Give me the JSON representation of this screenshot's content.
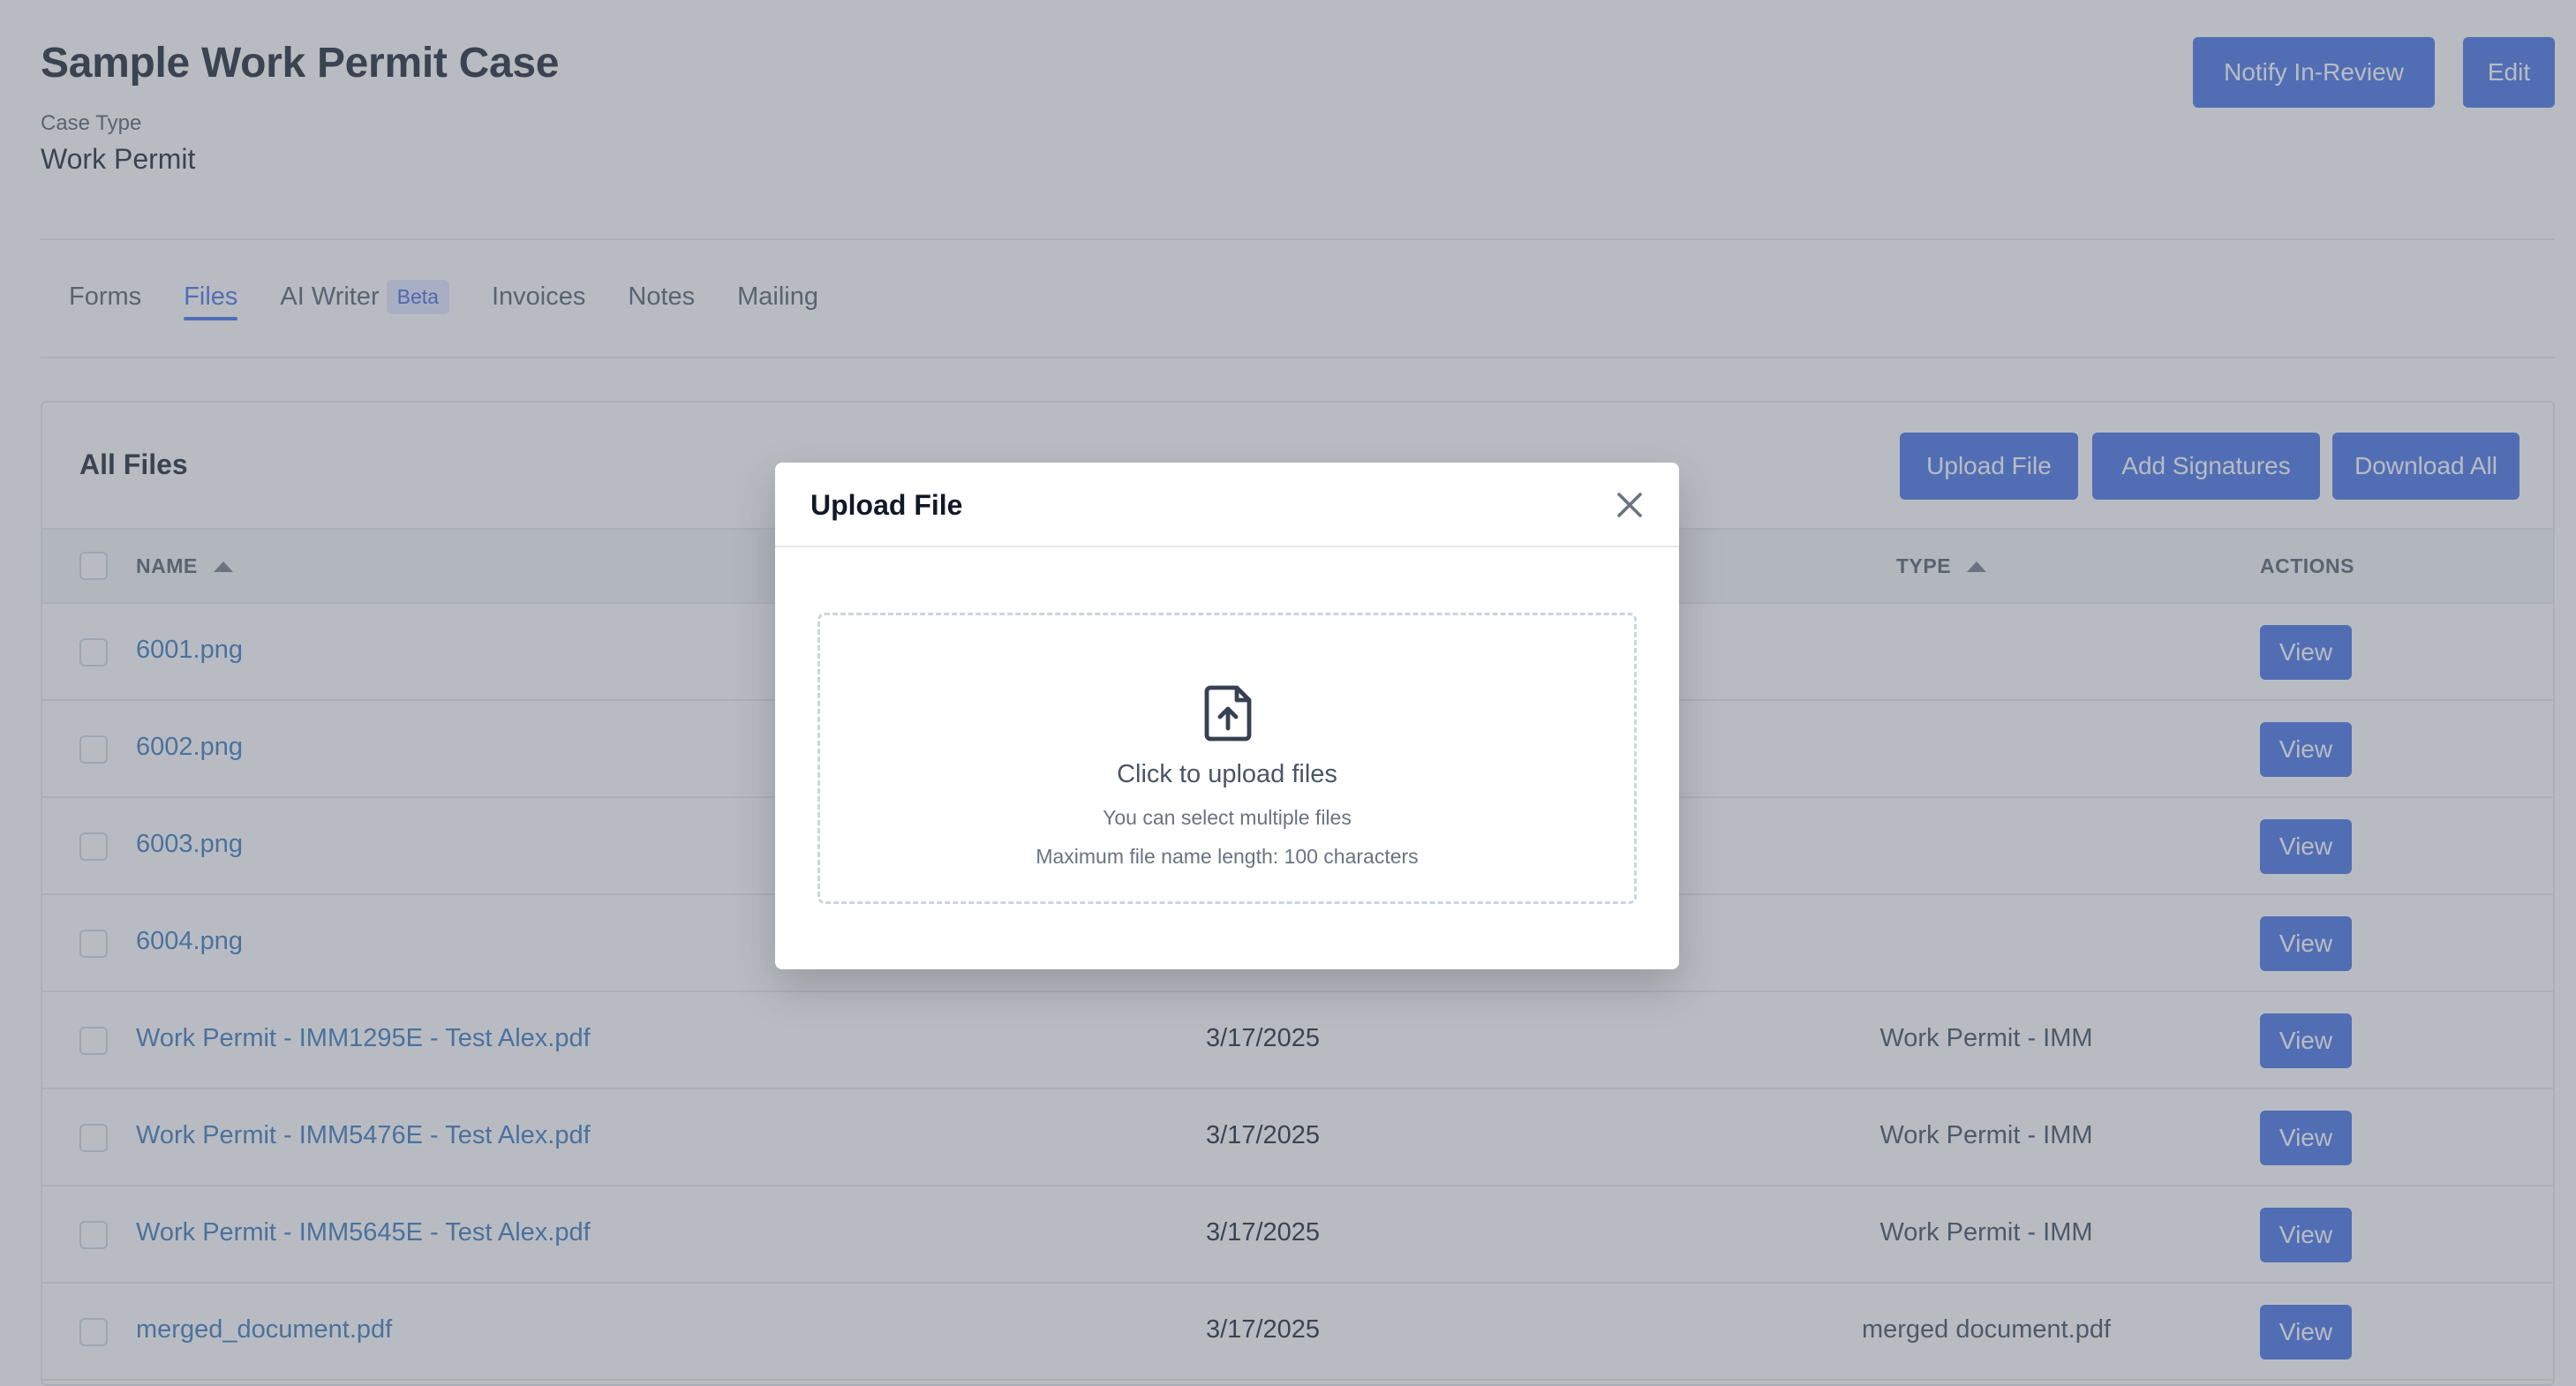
{
  "case": {
    "title": "Sample Work Permit Case",
    "type_label": "Case Type",
    "type_value": "Work Permit"
  },
  "header_actions": {
    "notify_label": "Notify In-Review",
    "edit_label": "Edit"
  },
  "tabs": [
    {
      "label": "Forms",
      "active": false
    },
    {
      "label": "Files",
      "active": true
    },
    {
      "label": "AI Writer",
      "badge": "Beta",
      "active": false
    },
    {
      "label": "Invoices",
      "active": false
    },
    {
      "label": "Notes",
      "active": false
    },
    {
      "label": "Mailing",
      "active": false
    }
  ],
  "files": {
    "title": "All Files",
    "actions": {
      "upload": "Upload File",
      "signatures": "Add Signatures",
      "download_all": "Download All"
    },
    "columns": {
      "name": "NAME",
      "type": "TYPE",
      "actions": "ACTIONS"
    },
    "view_label": "View",
    "rows": [
      {
        "name": "6001.png",
        "date": "",
        "type": ""
      },
      {
        "name": "6002.png",
        "date": "",
        "type": ""
      },
      {
        "name": "6003.png",
        "date": "",
        "type": ""
      },
      {
        "name": "6004.png",
        "date": "",
        "type": ""
      },
      {
        "name": "Work Permit - IMM1295E - Test Alex.pdf",
        "date": "3/17/2025",
        "type": "Work Permit - IMM"
      },
      {
        "name": "Work Permit - IMM5476E - Test Alex.pdf",
        "date": "3/17/2025",
        "type": "Work Permit - IMM"
      },
      {
        "name": "Work Permit - IMM5645E - Test Alex.pdf",
        "date": "3/17/2025",
        "type": "Work Permit - IMM"
      },
      {
        "name": "merged_document.pdf",
        "date": "3/17/2025",
        "type": "merged document.pdf"
      }
    ]
  },
  "modal": {
    "title": "Upload File",
    "dropzone": {
      "main_text": "Click to upload files",
      "sub_text_1": "You can select multiple files",
      "sub_text_2": "Maximum file name length: 100 characters"
    },
    "close_icon": "close-icon",
    "upload_icon": "file-upload-icon"
  },
  "colors": {
    "primary": "#3b6ae6",
    "link": "#2f6fb8",
    "overlay": "rgba(107,114,128,0.48)"
  }
}
